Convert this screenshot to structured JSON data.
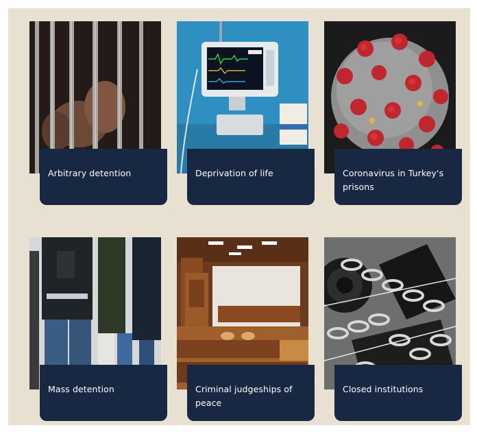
{
  "cards": [
    {
      "title": "Arbitrary detention",
      "image": "prison-bars-hands"
    },
    {
      "title": "Deprivation of life",
      "image": "medical-monitor"
    },
    {
      "title": "Coronavirus in Turkey's prisons",
      "image": "coronavirus"
    },
    {
      "title": "Mass detention",
      "image": "police-detainees"
    },
    {
      "title": "Criminal judgeships of peace",
      "image": "courtroom"
    },
    {
      "title": "Closed institutions",
      "image": "chained-camera"
    }
  ],
  "colors": {
    "background": "#e8e1d1",
    "label_box": "#182843",
    "label_text": "#ffffff"
  }
}
